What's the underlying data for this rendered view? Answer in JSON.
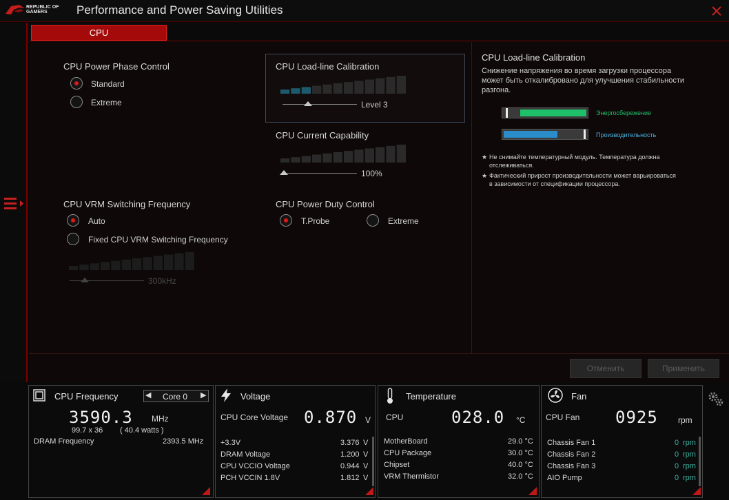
{
  "app": {
    "title": "Performance and Power Saving Utilities",
    "logo_line1": "REPUBLIC OF",
    "logo_line2": "GAMERS"
  },
  "tabs": [
    {
      "label": "CPU"
    }
  ],
  "settings": {
    "phase_control": {
      "title": "CPU Power Phase Control",
      "options": [
        "Standard",
        "Extreme"
      ],
      "selected": "Standard"
    },
    "llc": {
      "title": "CPU Load-line Calibration",
      "value_label": "Level 3",
      "level": 3,
      "levels": 8
    },
    "current_capability": {
      "title": "CPU Current Capability",
      "value_label": "100%"
    },
    "vrm_freq": {
      "title": "CPU VRM Switching Frequency",
      "options": [
        "Auto",
        "Fixed CPU VRM Switching Frequency"
      ],
      "selected": "Auto",
      "value_label": "300kHz"
    },
    "duty_control": {
      "title": "CPU Power Duty Control",
      "options": [
        "T.Probe",
        "Extreme"
      ],
      "selected": "T.Probe"
    }
  },
  "info": {
    "title": "CPU Load-line Calibration",
    "desc1": "Снижение напряжения во время загрузки процессора",
    "desc2": "может быть откалибровано для улучшения стабильности",
    "desc3": "разгона.",
    "legend_energy": "Энергосбережение",
    "legend_perf": "Производительность",
    "note1_line1": "Не снимайте температурный модуль. Температура должна",
    "note1_line2": "отслеживаться.",
    "note2_line1": "Фактический прирост производительности может варьироваться",
    "note2_line2": "в зависимости от спецификации процессора.",
    "energy_color": "#1fc06a",
    "perf_color": "#2a8cc8"
  },
  "buttons": {
    "cancel": "Отменить",
    "apply": "Применить"
  },
  "monitor": {
    "freq": {
      "title": "CPU Frequency",
      "core": "Core 0",
      "value": "3590.3",
      "unit": "MHz",
      "ratio": "99.7  x  36",
      "watts": "( 40.4  watts )",
      "dram_label": "DRAM Frequency",
      "dram_value": "2393.5  MHz"
    },
    "voltage": {
      "title": "Voltage",
      "main_label": "CPU Core Voltage",
      "main_value": "0.870",
      "main_unit": "V",
      "rows": [
        {
          "label": "+3.3V",
          "value": "3.376",
          "unit": "V"
        },
        {
          "label": "DRAM Voltage",
          "value": "1.200",
          "unit": "V"
        },
        {
          "label": "CPU VCCIO Voltage",
          "value": "0.944",
          "unit": "V"
        },
        {
          "label": "PCH VCCIN 1.8V",
          "value": "1.812",
          "unit": "V"
        }
      ]
    },
    "temperature": {
      "title": "Temperature",
      "main_label": "CPU",
      "main_value": "028.0",
      "main_unit": "°C",
      "rows": [
        {
          "label": "MotherBoard",
          "value": "29.0 °C"
        },
        {
          "label": "CPU Package",
          "value": "30.0 °C"
        },
        {
          "label": "Chipset",
          "value": "40.0 °C"
        },
        {
          "label": "VRM Thermistor",
          "value": "32.0 °C"
        }
      ]
    },
    "fan": {
      "title": "Fan",
      "main_label": "CPU Fan",
      "main_value": "0925",
      "main_unit": "rpm",
      "rows": [
        {
          "label": "Chassis Fan 1",
          "value": "0",
          "unit": "rpm"
        },
        {
          "label": "Chassis Fan 2",
          "value": "0",
          "unit": "rpm"
        },
        {
          "label": "Chassis Fan 3",
          "value": "0",
          "unit": "rpm"
        },
        {
          "label": "AIO Pump",
          "value": "0",
          "unit": "rpm"
        }
      ]
    }
  }
}
